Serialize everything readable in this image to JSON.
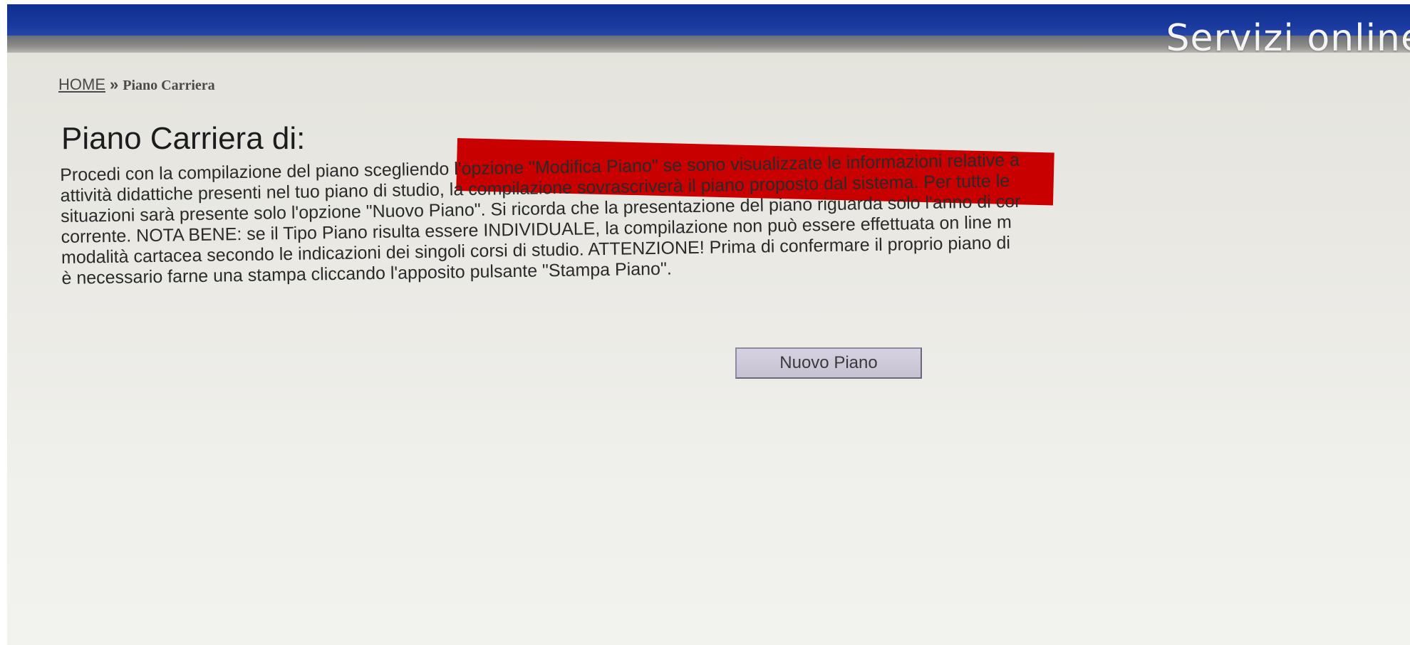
{
  "header": {
    "title": "Servizi online"
  },
  "breadcrumb": {
    "home": "HOME",
    "separator": "»",
    "current": "Piano Carriera"
  },
  "page": {
    "title": "Piano Carriera di:",
    "intro_lines": [
      "Procedi con la compilazione del piano scegliendo l'opzione \"Modifica Piano\" se sono visualizzate le informazioni relative a",
      "attività didattiche presenti nel tuo piano di studio, la compilazione sovrascriverà il piano proposto dal sistema. Per tutte le",
      "situazioni sarà presente solo l'opzione \"Nuovo Piano\". Si ricorda che la presentazione del piano riguarda solo l'anno di cor",
      "corrente. NOTA BENE: se il Tipo Piano risulta essere INDIVIDUALE, la compilazione non può essere effettuata on line m",
      "modalità cartacea secondo le indicazioni dei singoli corsi di studio. ATTENZIONE! Prima di confermare il proprio piano di",
      "è necessario farne una stampa cliccando l'apposito pulsante \"Stampa Piano\"."
    ]
  },
  "actions": {
    "new_plan_label": "Nuovo Piano"
  },
  "colors": {
    "header_blue": "#1a3aa0",
    "redaction_red": "#c90000",
    "button_bg": "#cbc6d6"
  }
}
